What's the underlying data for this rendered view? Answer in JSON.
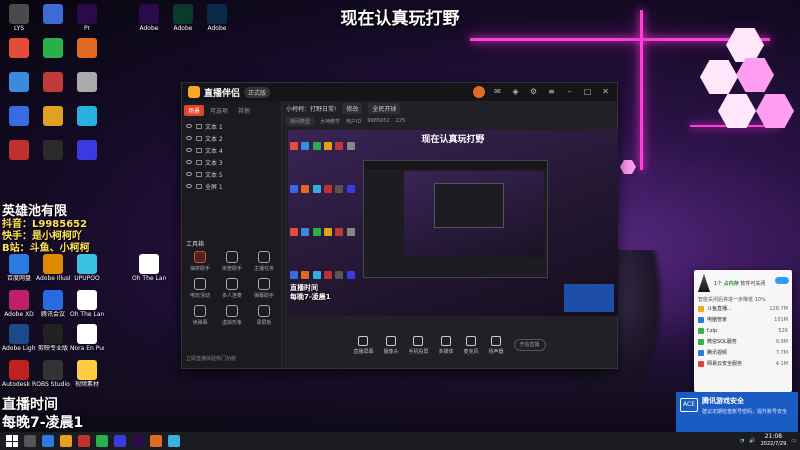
{
  "stream_title": "现在认真玩打野",
  "overlay": {
    "hero_name": "英雄池有限",
    "douyin": "抖音：L9985652",
    "kuaishou": "快手：是小柯柯吖",
    "bilibili": "B站：斗鱼、小柯柯",
    "live_time_label": "直播时间",
    "live_time_value": "每晚7-凌晨1"
  },
  "desktop_icons": [
    {
      "label": "LYS",
      "color": "#4a4a4a"
    },
    {
      "label": "",
      "color": "#3d6bd6"
    },
    {
      "label": "Pr",
      "color": "#2a0a4a"
    },
    {
      "label": "Adobe",
      "color": "#2a0a4a"
    },
    {
      "label": "Adobe",
      "color": "#0a3a2a"
    },
    {
      "label": "Adobe",
      "color": "#0a2a4a"
    },
    {
      "label": "",
      "color": "#e84a3a"
    },
    {
      "label": "",
      "color": "#2ab04a"
    },
    {
      "label": "",
      "color": "#e06a20"
    },
    {
      "label": "",
      "color": "#3a8ae0"
    },
    {
      "label": "",
      "color": "#c03a3a"
    },
    {
      "label": "",
      "color": "#aaaaaa"
    },
    {
      "label": "",
      "color": "#3a6ae0"
    },
    {
      "label": "",
      "color": "#e0a020"
    },
    {
      "label": "",
      "color": "#2ab0e0"
    },
    {
      "label": "",
      "color": "#c03030"
    },
    {
      "label": "",
      "color": "#2a2a2a"
    },
    {
      "label": "",
      "color": "#3a3ae0"
    }
  ],
  "desktop_icons_lower": [
    {
      "label": "百度网盘",
      "color": "#2a7ae0"
    },
    {
      "label": "Adobe Illustrat...",
      "color": "#e08a00"
    },
    {
      "label": "UPUPOO",
      "color": "#3ac0e0"
    },
    {
      "label": "Oh The Larceny...",
      "color": "#ffffff"
    },
    {
      "label": "Adobe XD",
      "color": "#c0206a"
    },
    {
      "label": "腾讯会议",
      "color": "#2a6ae0"
    },
    {
      "label": "Oh The Larceny...",
      "color": "#ffffff"
    },
    {
      "label": "Adobe Lightroo...",
      "color": "#1a4a8a"
    },
    {
      "label": "剪映专业版",
      "color": "#222222"
    },
    {
      "label": "Nora En Pure - L...",
      "color": "#ffffff"
    },
    {
      "label": "Autodesk ReCap",
      "color": "#c02020"
    },
    {
      "label": "OBS Studio",
      "color": "#333333"
    },
    {
      "label": "视频素材",
      "color": "#ffcc44"
    }
  ],
  "app": {
    "name": "直播伴侣",
    "version_tag": "正式版",
    "tabs": [
      "场景",
      "可选项",
      "其他"
    ],
    "scenes": [
      "文本 1",
      "文本 2",
      "文本 4",
      "文本 3",
      "文本 5",
      "全屏 1"
    ],
    "tools_header": "工具箱",
    "tools": [
      {
        "label": "抽奖助手",
        "hot": true
      },
      {
        "label": "房管助手",
        "hot": false
      },
      {
        "label": "主播任务",
        "hot": false
      },
      {
        "label": "电玩活动",
        "hot": false
      },
      {
        "label": "多人连麦",
        "hot": false
      },
      {
        "label": "弹幕助手",
        "hot": false
      },
      {
        "label": "读弹幕",
        "hot": false
      },
      {
        "label": "虚拟形象",
        "hot": false
      },
      {
        "label": "录屏板",
        "hot": false
      }
    ],
    "bottom_note": "立即直播体验热门功能",
    "live_bar": {
      "channel": "小柯柯：打野日常!",
      "edit": "修改",
      "category": "全民开球",
      "room_label": "房间类型",
      "mode": "大神教学",
      "id_label": "用户ID",
      "id_value": "9985652",
      "fans": "225"
    },
    "preview_title": "现在认真玩打野",
    "preview_overlay_1": "直播时间",
    "preview_overlay_2": "每晚7-凌晨1",
    "bottom_tools": [
      "直播屏幕",
      "摄像头",
      "手机投屏",
      "多媒体",
      "麦克风",
      "扬声器"
    ],
    "start_button": "开始直播"
  },
  "widget": {
    "title_prefix": "1个",
    "title_status": "占内存",
    "title_suffix": "软件可关闭",
    "subtitle": "智能关闭后将进一步降低 10%",
    "rows": [
      {
        "name": "斗鱼直播...",
        "value": "128.7M",
        "color": "#f5a623"
      },
      {
        "name": "电脑管家",
        "value": "101M",
        "color": "#2a7ae0"
      },
      {
        "name": "f.zip",
        "value": "52K",
        "color": "#3ab04a"
      },
      {
        "name": "微信SQL服务",
        "value": "9.9M",
        "color": "#3ab04a"
      },
      {
        "name": "腾讯视频",
        "value": "7.7M",
        "color": "#2a7ae0"
      },
      {
        "name": "网易云安全服务",
        "value": "4.1M",
        "color": "#e04040"
      }
    ]
  },
  "toast": {
    "title": "腾讯游戏安全",
    "body": "建议定期检查账号密码，提升账号安全",
    "logo": "ACE"
  },
  "taskbar": {
    "time": "21:08",
    "date": "2022/7/29"
  }
}
